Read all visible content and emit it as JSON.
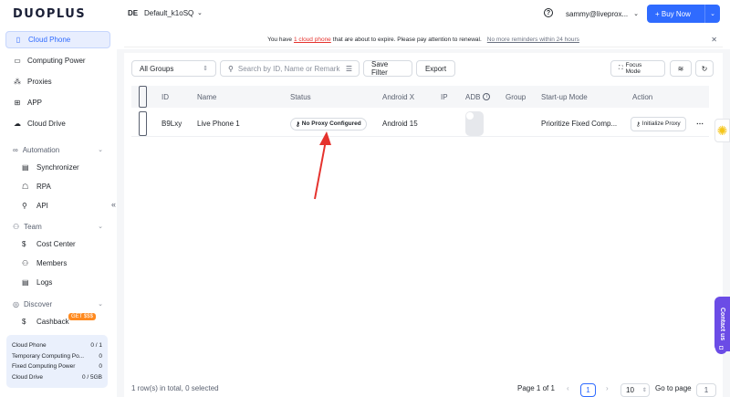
{
  "app": {
    "logo_text": "DUOPLUS"
  },
  "workspace": {
    "badge": "DE",
    "name": "Default_k1oSQ"
  },
  "header": {
    "help_label": "?",
    "user": "sammy@liveprox...",
    "buy_label": "+ Buy Now"
  },
  "sidebar": {
    "items": [
      {
        "label": "Cloud Phone",
        "icon": "phone-icon"
      },
      {
        "label": "Computing Power",
        "icon": "monitor-icon"
      },
      {
        "label": "Proxies",
        "icon": "network-icon"
      },
      {
        "label": "APP",
        "icon": "apps-icon"
      },
      {
        "label": "Cloud Drive",
        "icon": "cloud-icon"
      }
    ],
    "automation": {
      "label": "Automation",
      "items": [
        "Synchronizer",
        "RPA",
        "API"
      ]
    },
    "team": {
      "label": "Team",
      "items": [
        "Cost Center",
        "Members",
        "Logs"
      ]
    },
    "discover": {
      "label": "Discover",
      "items": [
        "Cashback"
      ],
      "badge": "GET $$$"
    },
    "usage": [
      {
        "label": "Cloud Phone",
        "value": "0 / 1"
      },
      {
        "label": "Temporary Computing Po...",
        "value": "0"
      },
      {
        "label": "Fixed Computing Power",
        "value": "0"
      },
      {
        "label": "Cloud Drive",
        "value": "0 / 5GB"
      }
    ]
  },
  "notice": {
    "prefix": "You have",
    "link": "1 cloud phone",
    "suffix": "that are about to expire. Please pay attention to renewal.",
    "dismiss": "No more reminders within 24 hours"
  },
  "toolbar": {
    "group_select": "All Groups",
    "search_placeholder": "Search by ID, Name or Remark",
    "save_filter": "Save Filter",
    "export": "Export",
    "focus_mode": "Focus Mode"
  },
  "table": {
    "columns": [
      "ID",
      "Name",
      "Status",
      "Android X",
      "IP",
      "ADB",
      "Group",
      "Start-up Mode",
      "Action"
    ],
    "rows": [
      {
        "id": "B9Lxy",
        "name": "Live Phone 1",
        "status": "No Proxy Configured",
        "android": "Android 15",
        "ip": "",
        "group": "",
        "startup": "Prioritize Fixed Comp...",
        "action": "Initialize Proxy"
      }
    ]
  },
  "footer": {
    "summary": "1 row(s) in total, 0 selected",
    "page_info": "Page 1 of 1",
    "current_page": "1",
    "page_size": "10",
    "goto_label": "Go to page",
    "goto_value": "1"
  },
  "contact": {
    "label": "Contact us"
  },
  "colors": {
    "accent": "#2f6bff",
    "arrow": "#e5322d",
    "contact": "#6b4ce6"
  }
}
